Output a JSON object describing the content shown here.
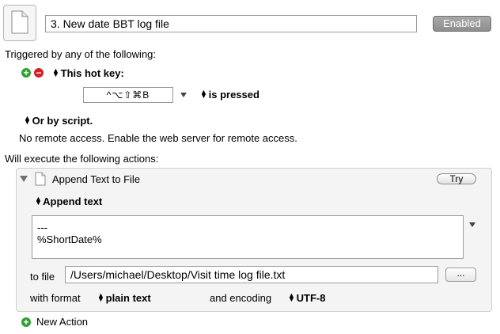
{
  "macro": {
    "name": "3. New date BBT log file",
    "enabled_label": "Enabled"
  },
  "triggers": {
    "heading": "Triggered by any of the following:",
    "hotkey_label": "This hot key:",
    "hotkey_value": "^⌥⇧⌘B",
    "pressed_label": "is pressed",
    "script_label": "Or by script.",
    "remote_text": "No remote access.  Enable the web server for remote access."
  },
  "actions": {
    "heading": "Will execute the following actions:",
    "action_title": "Append Text to File",
    "try_label": "Try",
    "mode_label": "Append text",
    "text_content": "---\n%ShortDate%",
    "to_file_label": "to file",
    "file_path": "/Users/michael/Desktop/Visit time log file.txt",
    "browse_label": "...",
    "format_label": "with format",
    "format_value": "plain text",
    "encoding_label": "and encoding",
    "encoding_value": "UTF-8",
    "new_action_label": "New Action"
  }
}
